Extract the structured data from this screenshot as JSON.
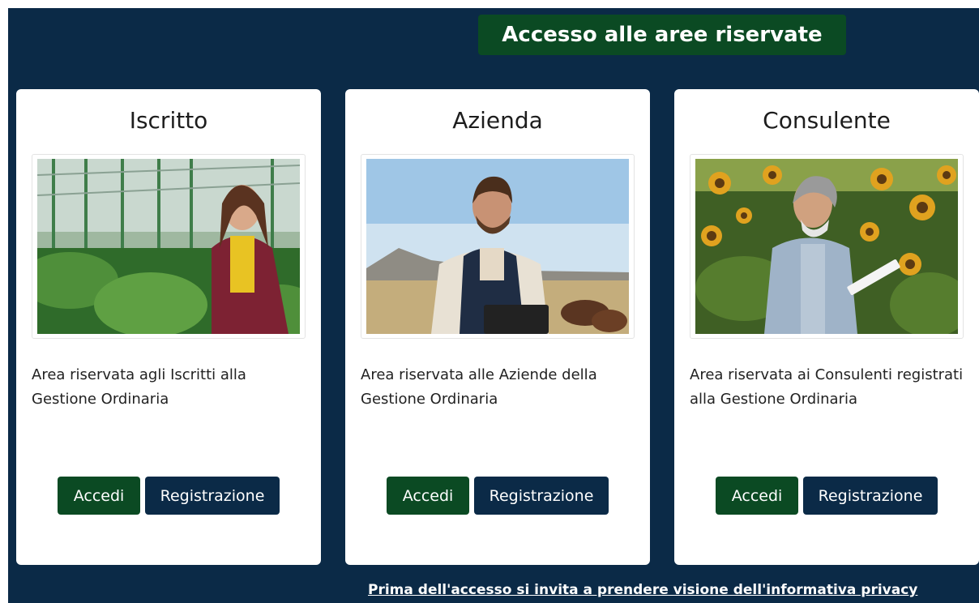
{
  "header": {
    "title": "Accesso alle aree riservate"
  },
  "cards": [
    {
      "title": "Iscritto",
      "image": "woman-in-greenhouse-photo",
      "description": "Area riservata agli Iscritti alla Gestione Ordinaria",
      "login_label": "Accedi",
      "register_label": "Registrazione"
    },
    {
      "title": "Azienda",
      "image": "farmer-with-tablet-photo",
      "description": "Area riservata alle Aziende della Gestione Ordinaria",
      "login_label": "Accedi",
      "register_label": "Registrazione"
    },
    {
      "title": "Consulente",
      "image": "man-in-sunflower-field-photo",
      "description": "Area riservata ai Consulenti registrati alla Gestione Ordinaria",
      "login_label": "Accedi",
      "register_label": "Registrazione"
    }
  ],
  "footer": {
    "privacy_link": "Prima dell'accesso si invita a prendere visione dell'informativa privacy"
  },
  "colors": {
    "background": "#0b2a47",
    "accent_green": "#0b4a23",
    "card": "#ffffff"
  }
}
